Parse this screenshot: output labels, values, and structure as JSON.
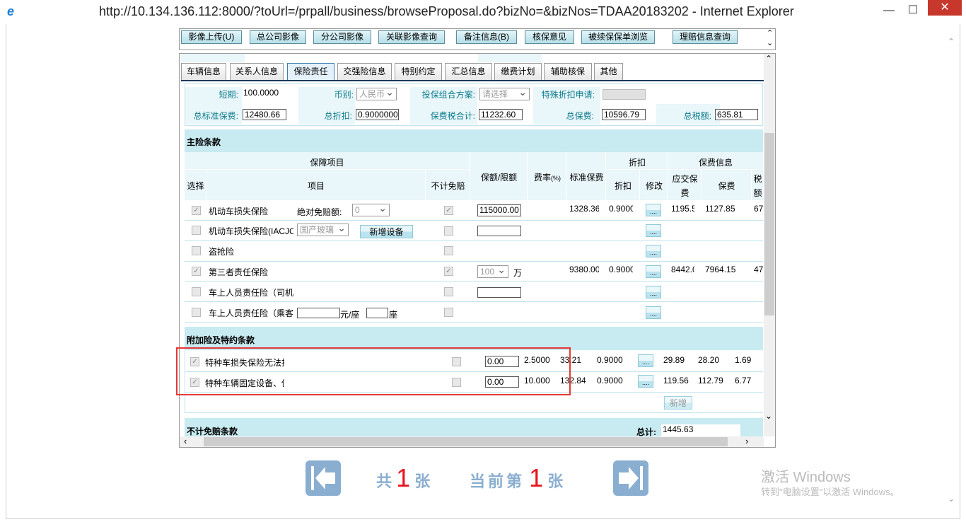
{
  "window": {
    "title": "http://10.134.136.112:8000/?toUrl=/prpall/business/browseProposal.do?bizNo=&bizNos=TDAA20183202 - Internet Explorer",
    "minimize": "—",
    "maximize": "☐",
    "close": "✕"
  },
  "toolbar": [
    "影像上传(U)",
    "总公司影像",
    "分公司影像",
    "关联影像查询",
    "备注信息(B)",
    "核保意见",
    "被续保保单浏览",
    "理赔信息查询"
  ],
  "tabs": [
    "车辆信息",
    "关系人信息",
    "保险责任",
    "交强险信息",
    "特别约定",
    "汇总信息",
    "缴费计划",
    "辅助核保",
    "其他"
  ],
  "summary": {
    "short_label": "短期:",
    "short_value": "100.0000",
    "currency_label": "币别:",
    "currency_value": "人民币",
    "plan_label": "投保组合方案:",
    "plan_value": "请选择",
    "special_label": "特殊折扣申请:",
    "std_premium_label": "总标准保费:",
    "std_premium": "12480.66",
    "discount_label": "总折扣:",
    "discount": "0.9000000",
    "tax_total_label": "保费税合计:",
    "tax_total": "11232.60",
    "premium_label": "总保费:",
    "premium": "10596.79",
    "tax_label": "总税额:",
    "tax": "635.81"
  },
  "main": {
    "section": "主险条款",
    "headers": {
      "coverage": "保障项目",
      "select": "选择",
      "item": "项目",
      "nodeduct": "不计免赔",
      "amount": "保额/限额",
      "rate": "费率",
      "rate_unit": "(%)",
      "std": "标准保费",
      "discount": "折扣",
      "disc": "折扣",
      "modify": "修改",
      "prem_info": "保费信息",
      "due": "应交保费",
      "prem": "保费",
      "tax": "税额"
    },
    "rows": [
      {
        "name": "机动车损失保险",
        "checked": true,
        "nd_checked": true,
        "extra_label": "绝对免赔额:",
        "extra_select": "0",
        "amount": "115000.00",
        "std": "1328.36",
        "disc": "0.9000",
        "due": "1195.5",
        "prem": "1127.85",
        "tax": "67"
      },
      {
        "name": "机动车损失保险(IACJC",
        "checked": false,
        "extra_select": "国产玻璃",
        "extra_button": "新增设备",
        "amount": ""
      },
      {
        "name": "盗抢险",
        "checked": false
      },
      {
        "name": "第三者责任保险",
        "checked": true,
        "nd_checked": true,
        "amount_select": "100",
        "unit": "万",
        "std": "9380.00",
        "disc": "0.9000",
        "due": "8442.0",
        "prem": "7964.15",
        "tax": "47"
      },
      {
        "name": "车上人员责任险（司机",
        "checked": false,
        "amount": ""
      },
      {
        "name": "车上人员责任险（乘客",
        "checked": false,
        "per_seat_unit": "元/座",
        "seat_unit": "座"
      }
    ],
    "modify_button": "...."
  },
  "addon": {
    "section": "附加险及特约条款",
    "rows": [
      {
        "name": "特种车损失保险无法找",
        "checked": true,
        "amount": "0.00",
        "rate": "2.5000",
        "std": "33.21",
        "disc": "0.9000",
        "due": "29.89",
        "prem": "28.20",
        "tax": "1.69"
      },
      {
        "name": "特种车辆固定设备、仪",
        "checked": true,
        "amount": "0.00",
        "rate": "10.000",
        "std": "132.84",
        "disc": "0.9000",
        "due": "119.56",
        "prem": "112.79",
        "tax": "6.77"
      }
    ],
    "add_button": "新增"
  },
  "nodeduct": {
    "section": "不计免赔条款",
    "total_label": "总计:",
    "total": "1445.63"
  },
  "pager": {
    "total_prefix": "共",
    "total": "1",
    "total_suffix": "张",
    "current_prefix": "当前第",
    "current": "1",
    "current_suffix": "张"
  },
  "watermark": {
    "line1": "激活 Windows",
    "line2": "转到\"电脑设置\"以激活 Windows。"
  },
  "colors": {
    "accent": "#0b7c8c",
    "band": "#c8eaf1",
    "pager": "#8aaed0",
    "highlight": "#e53935"
  }
}
